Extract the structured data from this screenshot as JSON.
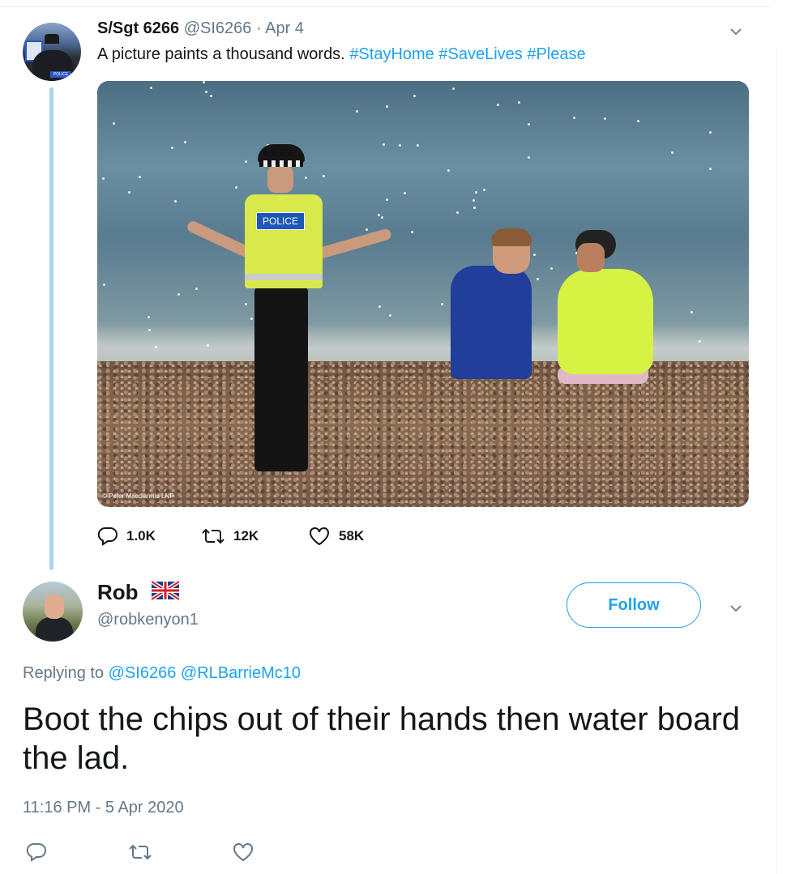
{
  "tweet1": {
    "name": "S/Sgt 6266",
    "handle": "@SI6266",
    "separator": "·",
    "date": "Apr 4",
    "text_plain": "A picture paints a thousand words. ",
    "hashtags": [
      "#StayHome",
      "#SaveLives",
      "#Please"
    ],
    "avatar_tag": "POLICE",
    "image": {
      "vest_label": "POLICE",
      "credit": "© Peter Macdiarmid LNP"
    },
    "actions": {
      "replies": "1.0K",
      "retweets": "12K",
      "likes": "58K"
    },
    "icons": [
      "chevron-down-icon",
      "reply-icon",
      "retweet-icon",
      "like-icon"
    ]
  },
  "tweet2": {
    "name": "Rob",
    "flag": "uk-flag",
    "handle": "@robkenyon1",
    "follow_label": "Follow",
    "replying_prefix": "Replying to",
    "replying_to": [
      "@SI6266",
      "@RLBarrieMc10"
    ],
    "text": "Boot the chips out of their hands then water board the lad.",
    "timestamp": "11:16 PM - 5 Apr 2020",
    "icons": [
      "reply-icon",
      "retweet-icon",
      "like-icon",
      "chevron-down-icon"
    ]
  },
  "colors": {
    "accent": "#1da1f2",
    "muted": "#657786",
    "text": "#14171a",
    "thread_line": "#a6d5ef"
  }
}
